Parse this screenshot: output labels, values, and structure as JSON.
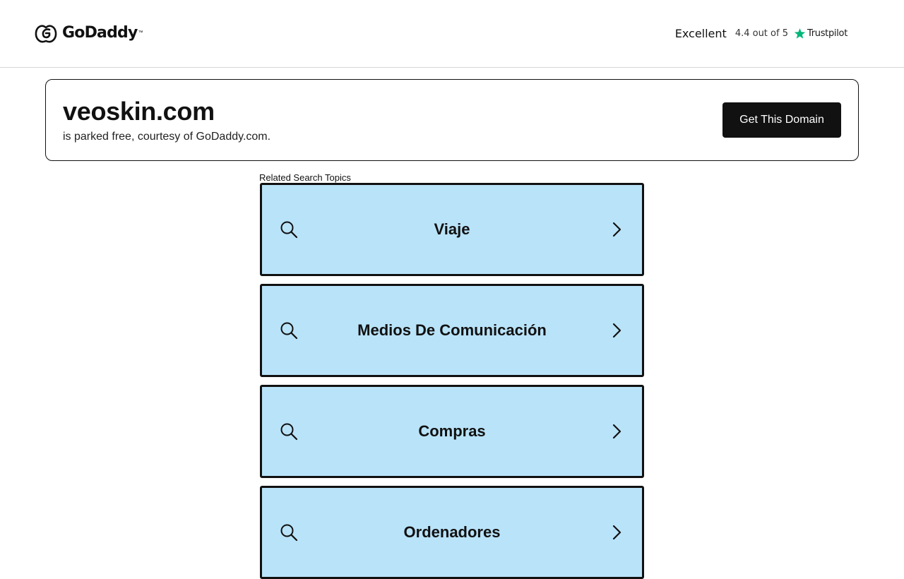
{
  "header": {
    "brand": "GoDaddy",
    "trustpilot": {
      "rating_word": "Excellent",
      "score_text": "4.4 out of 5",
      "brand": "Trustpilot",
      "star_color": "#00b67a"
    }
  },
  "domain_card": {
    "domain": "veoskin.com",
    "subtitle": "is parked free, courtesy of GoDaddy.com.",
    "cta_label": "Get This Domain"
  },
  "topics": {
    "heading": "Related Search Topics",
    "items": [
      {
        "label": "Viaje"
      },
      {
        "label": "Medios De Comunicación"
      },
      {
        "label": "Compras"
      },
      {
        "label": "Ordenadores"
      }
    ]
  },
  "colors": {
    "topic_bg": "#b9e3f9",
    "cta_bg": "#111111"
  },
  "icons": {
    "topic_left": "search-icon",
    "topic_right": "chevron-right-icon"
  }
}
